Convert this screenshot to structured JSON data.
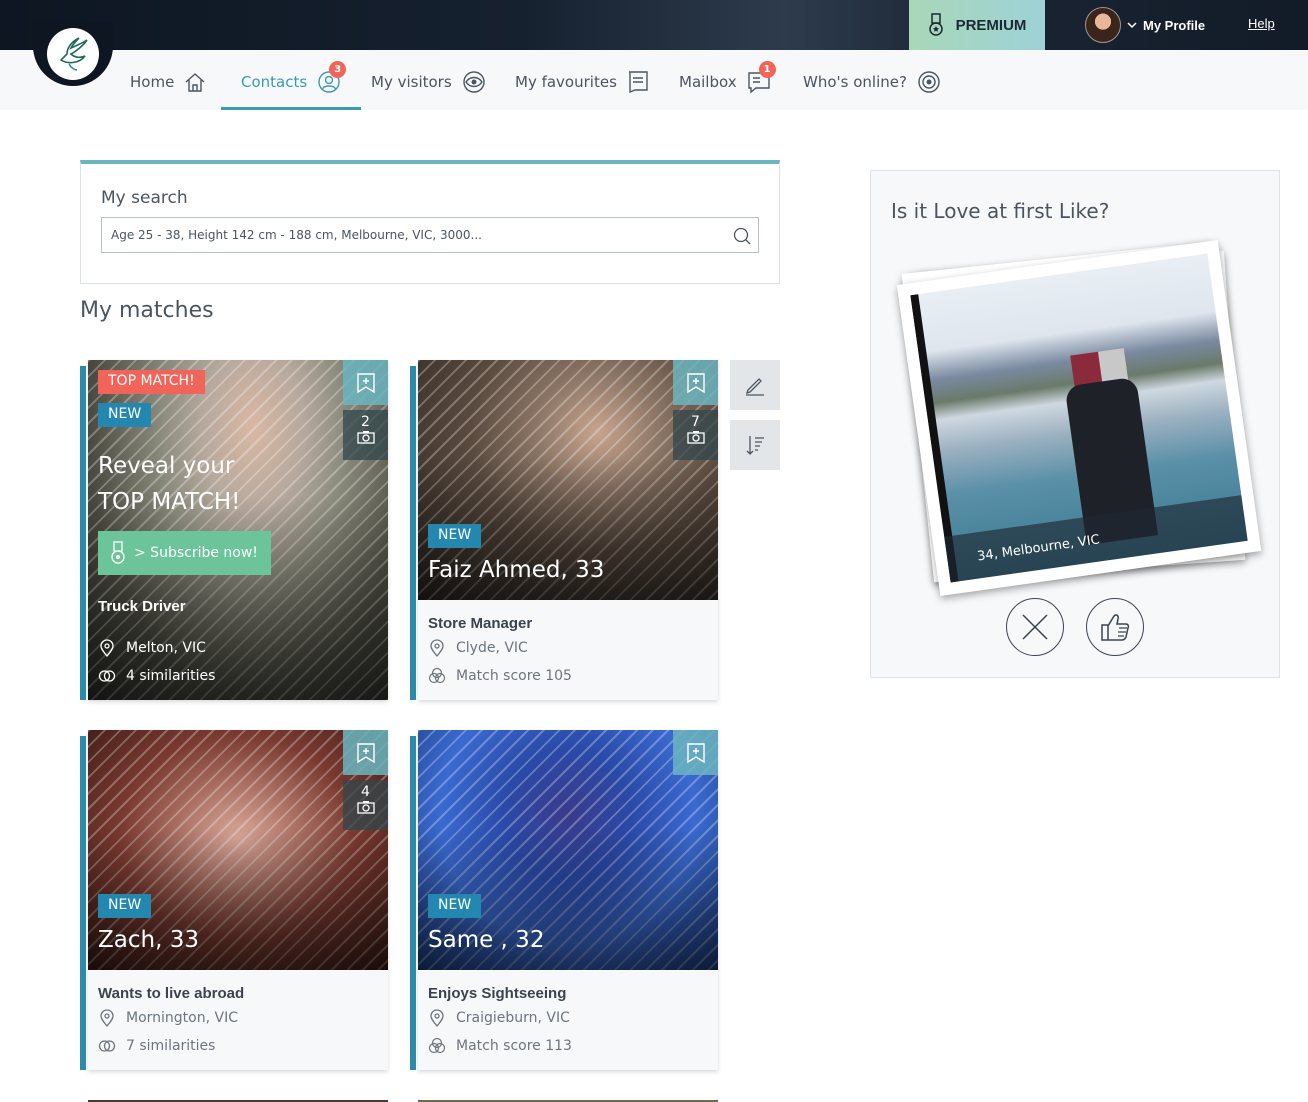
{
  "header": {
    "premium_label": "PREMIUM",
    "profile_label": "My Profile",
    "help_label": "Help"
  },
  "nav": {
    "items": [
      {
        "label": "Home"
      },
      {
        "label": "Contacts",
        "badge": "3"
      },
      {
        "label": "My visitors"
      },
      {
        "label": "My favourites"
      },
      {
        "label": "Mailbox",
        "badge": "1"
      },
      {
        "label": "Who's online?"
      }
    ],
    "active": "Contacts"
  },
  "search": {
    "title": "My search",
    "value": "Age 25 - 38, Height 142 cm - 188 cm, Melbourne, VIC, 3000..."
  },
  "matches": {
    "title": "My matches",
    "cards": [
      {
        "top_badge": "TOP MATCH!",
        "new_badge": "NEW",
        "reveal_line1": "Reveal your",
        "reveal_line2": "TOP MATCH!",
        "subscribe_label": "> Subscribe now!",
        "photo_count": "2",
        "occupation": "Truck Driver",
        "location": "Melton, VIC",
        "stat": "4 similarities"
      },
      {
        "new_badge": "NEW",
        "name": "Faiz Ahmed, 33",
        "photo_count": "7",
        "occupation": "Store Manager",
        "location": "Clyde, VIC",
        "stat": "Match score 105"
      },
      {
        "new_badge": "NEW",
        "name": "Zach, 33",
        "photo_count": "4",
        "occupation": "Wants to live abroad",
        "location": "Mornington, VIC",
        "stat": "7 similarities"
      },
      {
        "new_badge": "NEW",
        "name": "Same , 32",
        "occupation": "Enjoys Sightseeing",
        "location": "Craigieburn, VIC",
        "stat": "Match score 113"
      }
    ]
  },
  "love": {
    "title": "Is it Love at first Like?",
    "photo_caption": "34, Melbourne, VIC"
  },
  "colors": {
    "accent": "#3a9bb0",
    "new_badge": "#2387b0",
    "top_match": "#f0645a",
    "subscribe": "#6cc49a",
    "topbar": "#0d1621"
  }
}
